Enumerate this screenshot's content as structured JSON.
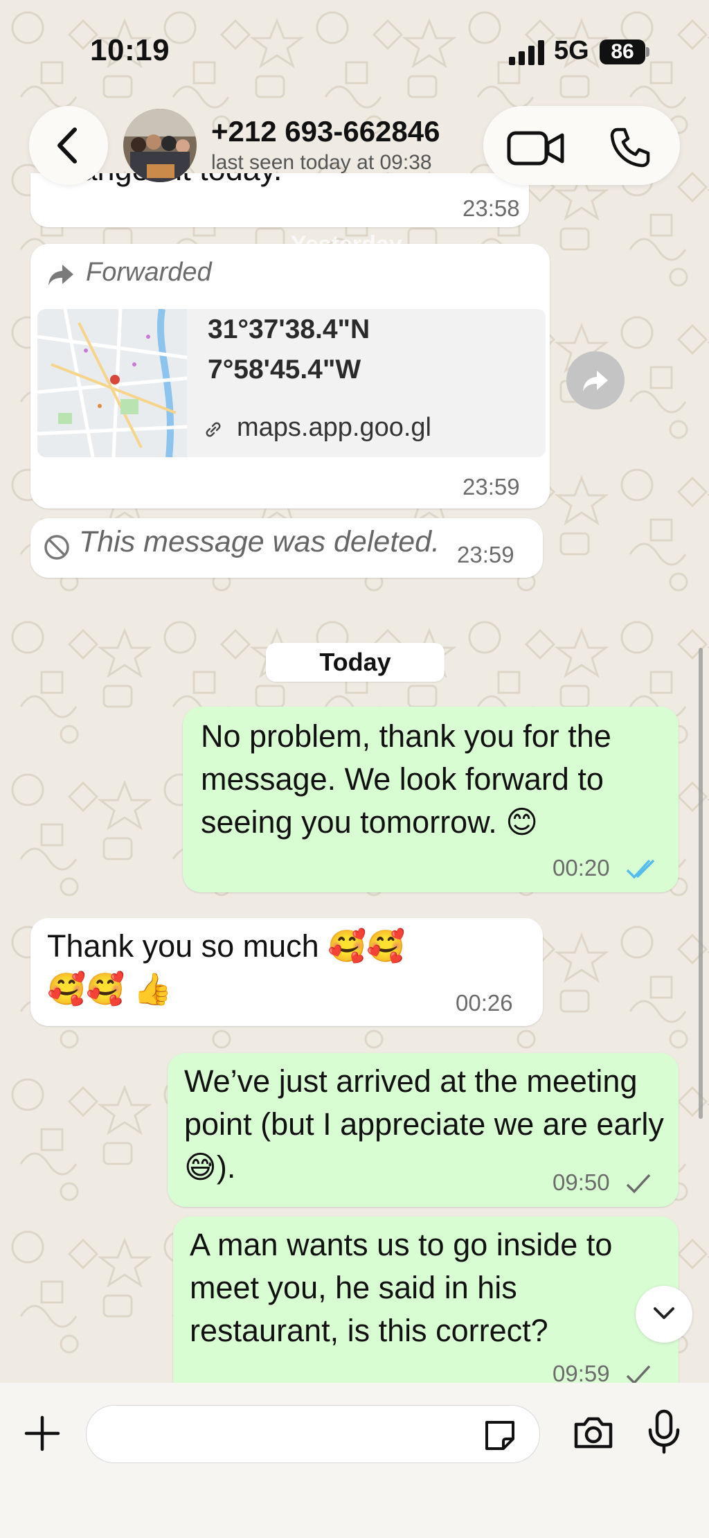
{
  "status_bar": {
    "time": "10:19",
    "network": "5G",
    "battery": "86"
  },
  "header": {
    "contact_name": "+212 693-662846",
    "last_seen": "last seen today at 09:38",
    "icons": [
      "back-chevron-icon",
      "video-call-icon",
      "phone-call-icon"
    ]
  },
  "chat": {
    "partial_message": {
      "text": "changed it today.",
      "time": "23:58"
    },
    "sticky_date": "Yesterday",
    "forwarded_message": {
      "label": "Forwarded",
      "latitude": "31°37'38.4\"N",
      "longitude": "7°58'45.4\"W",
      "link": "maps.app.goo.gl",
      "time": "23:59"
    },
    "deleted_message": {
      "text": "This message was deleted.",
      "time": "23:59"
    },
    "date_divider": "Today",
    "messages": [
      {
        "direction": "out",
        "text": "No problem, thank you for the message. We look forward to seeing you tomorrow. 😊",
        "time": "00:20",
        "status": "read"
      },
      {
        "direction": "in",
        "text": "Thank you so much 🥰🥰🥰🥰 👍",
        "time": "00:26"
      },
      {
        "direction": "out",
        "text": "We’ve just arrived at the meeting point (but I appreciate we are early 😅).",
        "time": "09:50",
        "status": "sent"
      },
      {
        "direction": "out",
        "text": "A man wants us to go inside to meet you, he said in his restaurant, is this correct?",
        "time": "09:59",
        "status": "sent"
      }
    ]
  },
  "input_bar": {
    "placeholder": "",
    "icons": [
      "plus-icon",
      "sticker-icon",
      "camera-icon",
      "microphone-icon"
    ]
  },
  "colors": {
    "incoming": "#ffffff",
    "outgoing": "#d9fdd3",
    "background": "#efeae2",
    "read_ticks": "#53bdeb"
  }
}
